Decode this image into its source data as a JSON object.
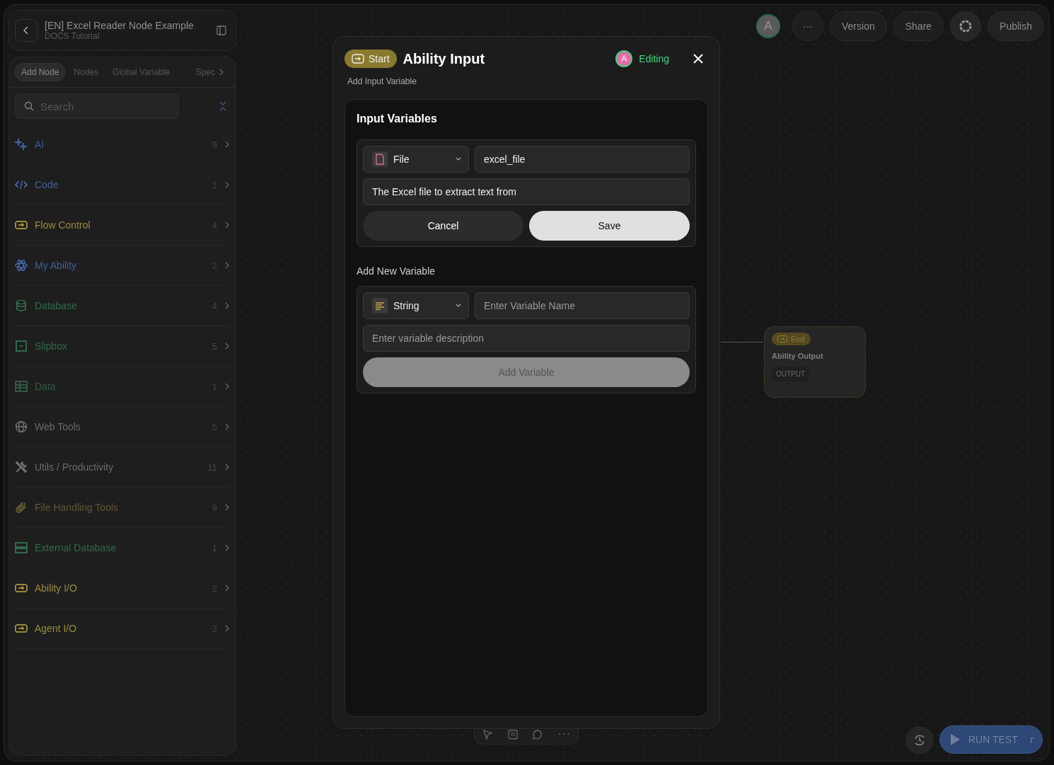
{
  "project": {
    "title": "[EN] Excel Reader Node Example",
    "subtitle": "DOCS Tutorial"
  },
  "sidebar": {
    "tabs": [
      {
        "label": "Add Node",
        "selected": true
      },
      {
        "label": "Nodes",
        "selected": false
      },
      {
        "label": "Global Variable",
        "selected": false
      },
      {
        "label": "Spec",
        "selected": false
      }
    ],
    "search": {
      "placeholder": "Search"
    },
    "categories": [
      {
        "label": "AI",
        "count": "9",
        "color": "#3f5f9a"
      },
      {
        "label": "Code",
        "count": "1",
        "color": "#3f5f9a"
      },
      {
        "label": "Flow Control",
        "count": "4",
        "color": "#9a8a3a"
      },
      {
        "label": "My Ability",
        "count": "2",
        "color": "#3f5f9a"
      },
      {
        "label": "Database",
        "count": "4",
        "color": "#2f6a4a"
      },
      {
        "label": "Slipbox",
        "count": "5",
        "color": "#2f6a4a"
      },
      {
        "label": "Data",
        "count": "1",
        "color": "#2f5a40"
      },
      {
        "label": "Web Tools",
        "count": "5",
        "color": "#6a6a6a"
      },
      {
        "label": "Utils / Productivity",
        "count": "11",
        "color": "#6a6a6a"
      },
      {
        "label": "File Handling Tools",
        "count": "9",
        "color": "#5e5530"
      },
      {
        "label": "External Database",
        "count": "1",
        "color": "#2f6a4a"
      },
      {
        "label": "Ability I/O",
        "count": "2",
        "color": "#9a8a3a"
      },
      {
        "label": "Agent I/O",
        "count": "2",
        "color": "#9a8a3a"
      }
    ]
  },
  "header": {
    "avatar": "A",
    "more": "···",
    "buttons": [
      "Version",
      "Share"
    ],
    "publish": "Publish"
  },
  "modal": {
    "badge": "Start",
    "title": "Ability Input",
    "editor": {
      "avatar": "A",
      "status": "Editing"
    },
    "subtitle": "Add Input Variable",
    "section_title": "Input Variables",
    "variables": [
      {
        "type": "File",
        "name": "excel_file",
        "description": "The Excel file to extract text from"
      }
    ],
    "cancel": "Cancel",
    "save": "Save",
    "new_title": "Add New Variable",
    "new_variable": {
      "type": "String",
      "name_placeholder": "Enter Variable Name",
      "description_placeholder": "Enter variable description",
      "button": "Add Variable",
      "disabled": true
    }
  },
  "node": {
    "badge": "End",
    "title": "Ability Output",
    "tag": "OUTPUT"
  },
  "toolbar": {
    "more": "···"
  },
  "run": {
    "label": "RUN TEST",
    "shortcut": "r"
  }
}
